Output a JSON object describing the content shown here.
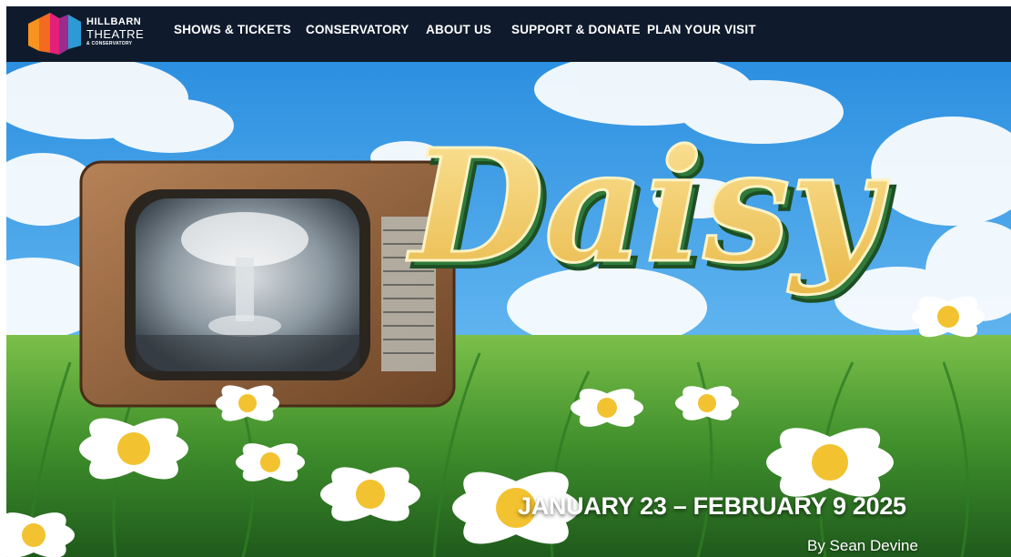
{
  "brand": {
    "line1": "HILLBARN",
    "line2": "THEATRE",
    "line3": "& CONSERVATORY",
    "logo_icon": "hillbarn-logo-icon",
    "colors": [
      "#f26b21",
      "#e4217a",
      "#2e9ad5"
    ]
  },
  "nav": {
    "items": [
      {
        "label": "SHOWS & TICKETS"
      },
      {
        "label": "CONSERVATORY"
      },
      {
        "label": "ABOUT US"
      },
      {
        "label": "SUPPORT & DONATE"
      },
      {
        "label": "PLAN YOUR VISIT"
      }
    ],
    "background": "#0f1b2d"
  },
  "hero": {
    "title_art": "Daisy",
    "dates": "JANUARY 23 – FEBRUARY 9 2025",
    "author": "By Sean Devine",
    "scene": [
      "sky",
      "clouds",
      "vintage-tv",
      "meadow",
      "daisies"
    ]
  }
}
